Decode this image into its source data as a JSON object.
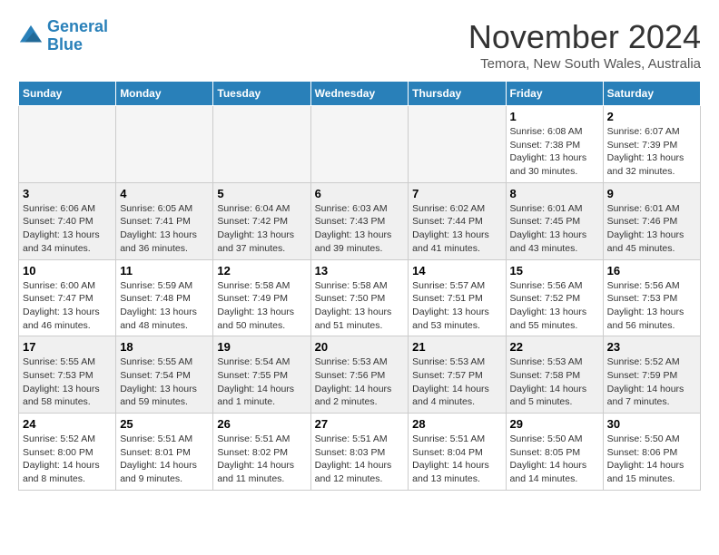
{
  "header": {
    "logo_line1": "General",
    "logo_line2": "Blue",
    "month_title": "November 2024",
    "subtitle": "Temora, New South Wales, Australia"
  },
  "weekdays": [
    "Sunday",
    "Monday",
    "Tuesday",
    "Wednesday",
    "Thursday",
    "Friday",
    "Saturday"
  ],
  "weeks": [
    [
      {
        "day": "",
        "info": ""
      },
      {
        "day": "",
        "info": ""
      },
      {
        "day": "",
        "info": ""
      },
      {
        "day": "",
        "info": ""
      },
      {
        "day": "",
        "info": ""
      },
      {
        "day": "1",
        "info": "Sunrise: 6:08 AM\nSunset: 7:38 PM\nDaylight: 13 hours\nand 30 minutes."
      },
      {
        "day": "2",
        "info": "Sunrise: 6:07 AM\nSunset: 7:39 PM\nDaylight: 13 hours\nand 32 minutes."
      }
    ],
    [
      {
        "day": "3",
        "info": "Sunrise: 6:06 AM\nSunset: 7:40 PM\nDaylight: 13 hours\nand 34 minutes."
      },
      {
        "day": "4",
        "info": "Sunrise: 6:05 AM\nSunset: 7:41 PM\nDaylight: 13 hours\nand 36 minutes."
      },
      {
        "day": "5",
        "info": "Sunrise: 6:04 AM\nSunset: 7:42 PM\nDaylight: 13 hours\nand 37 minutes."
      },
      {
        "day": "6",
        "info": "Sunrise: 6:03 AM\nSunset: 7:43 PM\nDaylight: 13 hours\nand 39 minutes."
      },
      {
        "day": "7",
        "info": "Sunrise: 6:02 AM\nSunset: 7:44 PM\nDaylight: 13 hours\nand 41 minutes."
      },
      {
        "day": "8",
        "info": "Sunrise: 6:01 AM\nSunset: 7:45 PM\nDaylight: 13 hours\nand 43 minutes."
      },
      {
        "day": "9",
        "info": "Sunrise: 6:01 AM\nSunset: 7:46 PM\nDaylight: 13 hours\nand 45 minutes."
      }
    ],
    [
      {
        "day": "10",
        "info": "Sunrise: 6:00 AM\nSunset: 7:47 PM\nDaylight: 13 hours\nand 46 minutes."
      },
      {
        "day": "11",
        "info": "Sunrise: 5:59 AM\nSunset: 7:48 PM\nDaylight: 13 hours\nand 48 minutes."
      },
      {
        "day": "12",
        "info": "Sunrise: 5:58 AM\nSunset: 7:49 PM\nDaylight: 13 hours\nand 50 minutes."
      },
      {
        "day": "13",
        "info": "Sunrise: 5:58 AM\nSunset: 7:50 PM\nDaylight: 13 hours\nand 51 minutes."
      },
      {
        "day": "14",
        "info": "Sunrise: 5:57 AM\nSunset: 7:51 PM\nDaylight: 13 hours\nand 53 minutes."
      },
      {
        "day": "15",
        "info": "Sunrise: 5:56 AM\nSunset: 7:52 PM\nDaylight: 13 hours\nand 55 minutes."
      },
      {
        "day": "16",
        "info": "Sunrise: 5:56 AM\nSunset: 7:53 PM\nDaylight: 13 hours\nand 56 minutes."
      }
    ],
    [
      {
        "day": "17",
        "info": "Sunrise: 5:55 AM\nSunset: 7:53 PM\nDaylight: 13 hours\nand 58 minutes."
      },
      {
        "day": "18",
        "info": "Sunrise: 5:55 AM\nSunset: 7:54 PM\nDaylight: 13 hours\nand 59 minutes."
      },
      {
        "day": "19",
        "info": "Sunrise: 5:54 AM\nSunset: 7:55 PM\nDaylight: 14 hours\nand 1 minute."
      },
      {
        "day": "20",
        "info": "Sunrise: 5:53 AM\nSunset: 7:56 PM\nDaylight: 14 hours\nand 2 minutes."
      },
      {
        "day": "21",
        "info": "Sunrise: 5:53 AM\nSunset: 7:57 PM\nDaylight: 14 hours\nand 4 minutes."
      },
      {
        "day": "22",
        "info": "Sunrise: 5:53 AM\nSunset: 7:58 PM\nDaylight: 14 hours\nand 5 minutes."
      },
      {
        "day": "23",
        "info": "Sunrise: 5:52 AM\nSunset: 7:59 PM\nDaylight: 14 hours\nand 7 minutes."
      }
    ],
    [
      {
        "day": "24",
        "info": "Sunrise: 5:52 AM\nSunset: 8:00 PM\nDaylight: 14 hours\nand 8 minutes."
      },
      {
        "day": "25",
        "info": "Sunrise: 5:51 AM\nSunset: 8:01 PM\nDaylight: 14 hours\nand 9 minutes."
      },
      {
        "day": "26",
        "info": "Sunrise: 5:51 AM\nSunset: 8:02 PM\nDaylight: 14 hours\nand 11 minutes."
      },
      {
        "day": "27",
        "info": "Sunrise: 5:51 AM\nSunset: 8:03 PM\nDaylight: 14 hours\nand 12 minutes."
      },
      {
        "day": "28",
        "info": "Sunrise: 5:51 AM\nSunset: 8:04 PM\nDaylight: 14 hours\nand 13 minutes."
      },
      {
        "day": "29",
        "info": "Sunrise: 5:50 AM\nSunset: 8:05 PM\nDaylight: 14 hours\nand 14 minutes."
      },
      {
        "day": "30",
        "info": "Sunrise: 5:50 AM\nSunset: 8:06 PM\nDaylight: 14 hours\nand 15 minutes."
      }
    ]
  ]
}
